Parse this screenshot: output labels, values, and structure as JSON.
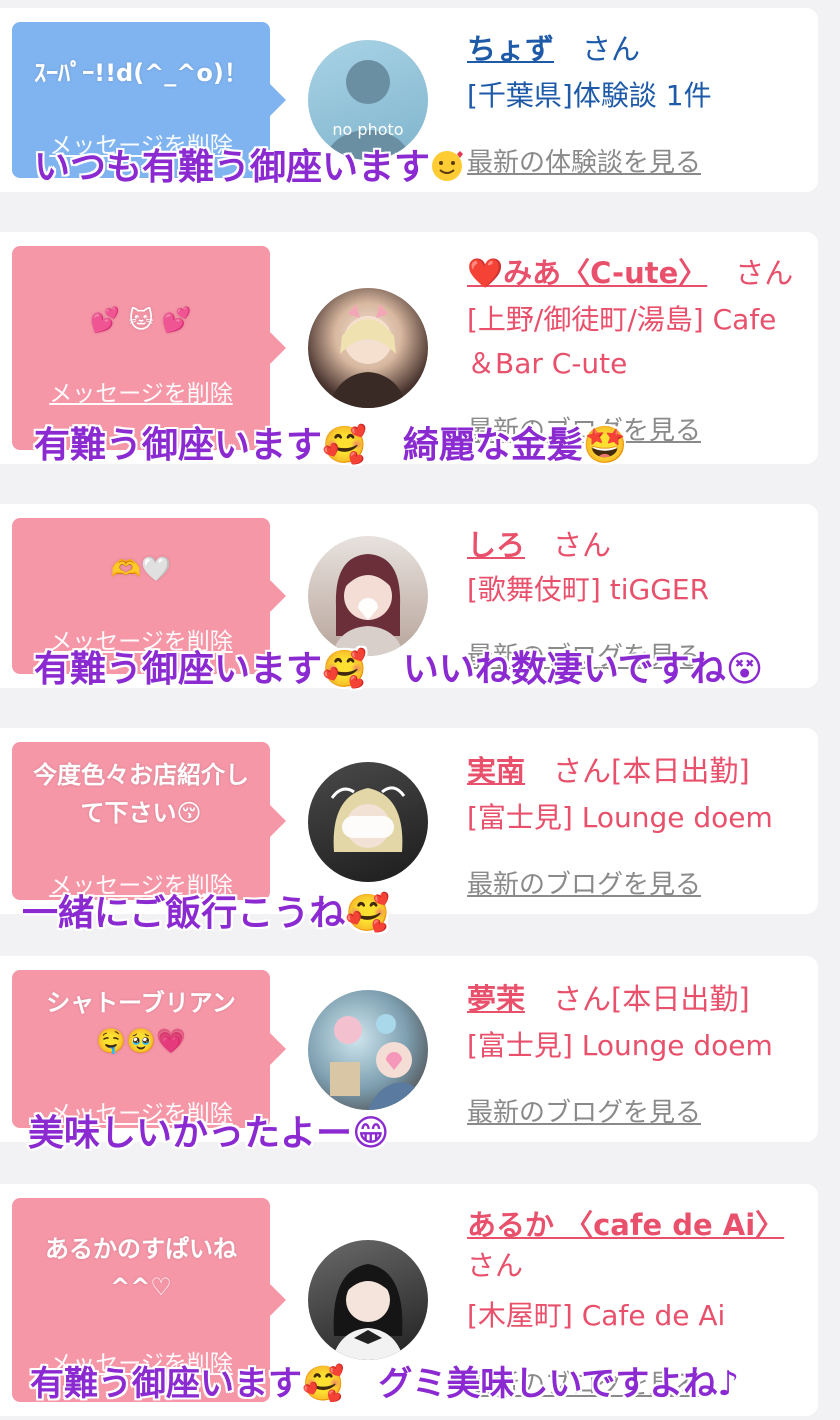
{
  "delete_label": "メッセージを削除",
  "san_label": "さん",
  "cards": [
    {
      "bubble": "ｽｰﾊﾟｰ!!d(^_^o)！",
      "name": "ちょず",
      "shop": "[千葉県]体験談 1件",
      "blog": "最新の体験談を見る",
      "avatar_text": "no photo",
      "overlay": "いつも有難う御座います"
    },
    {
      "bubble": "💕 🐱 💕",
      "name": "❤️みあ〈C-ute〉",
      "shop": "[上野/御徒町/湯島] Cafe ＆Bar C-ute",
      "blog": "最新のブログを見る",
      "overlay": "有難う御座います🥰　綺麗な金髪🤩"
    },
    {
      "bubble": "🫶🤍",
      "name": "しろ",
      "shop": "[歌舞伎町] tiGGER",
      "blog": "最新のブログを見る",
      "overlay": "有難う御座います🥰　いいね数凄いですね😵"
    },
    {
      "bubble": "今度色々お店紹介して下さい😚",
      "name": "実南",
      "status": "[本日出勤]",
      "shop": "[富士見] Lounge doem",
      "blog": "最新のブログを見る",
      "overlay": "一緒にご飯行こうね🥰"
    },
    {
      "bubble": "シャトーブリアン🤤🥹💗",
      "name": "夢茉",
      "status": "[本日出勤]",
      "shop": "[富士見] Lounge doem",
      "blog": "最新のブログを見る",
      "overlay": "美味しいかったよー😁"
    },
    {
      "bubble": "あるかのすぱいね^^♡",
      "name": "あるか 〈cafe de Ai〉",
      "shop": "[木屋町] Cafe de Ai",
      "blog": "最新のブログを見る",
      "overlay": "有難う御座います🥰　グミ美味しいですよね♪"
    }
  ],
  "colors": {
    "accent_pink": "#e8506b",
    "link_blue": "#1e5aa8",
    "bubble_pink": "#f697a8",
    "bubble_blue": "#80b4f0",
    "overlay_purple": "#8a2ad0"
  }
}
